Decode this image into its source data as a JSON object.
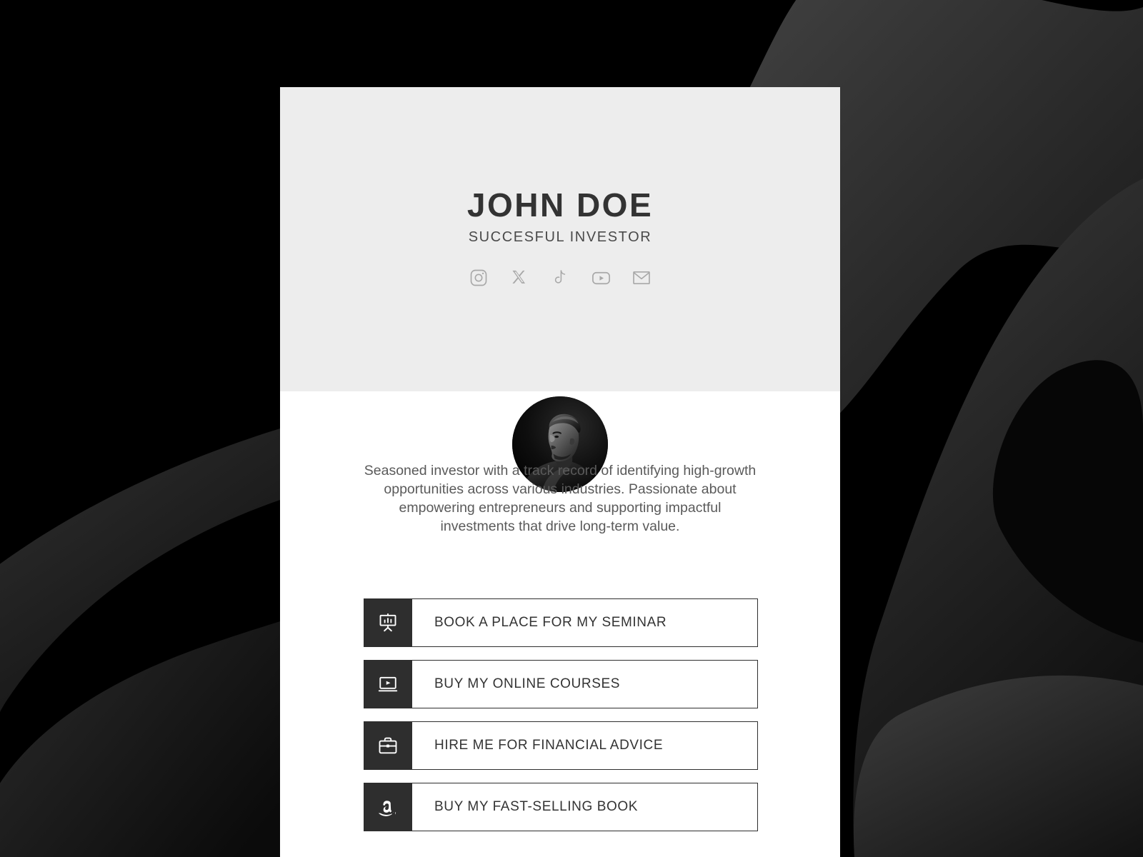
{
  "background": {
    "base_color": "#000000",
    "blob_colors": [
      "#2b2b2b",
      "#333333",
      "#1a1a1a",
      "#3a3a3a",
      "#202020"
    ]
  },
  "card": {
    "header_bg": "#ededed",
    "body_bg": "#ffffff",
    "accent": "#2e2e2e"
  },
  "profile": {
    "name": "JOHN DOE",
    "tagline": "SUCCESFUL INVESTOR",
    "bio": "Seasoned investor with a track record of identifying high-growth opportunities across various industries. Passionate about empowering entrepreneurs and supporting impactful investments that drive long-term value.",
    "avatar_alt": "portrait-photo-of-man-in-profile"
  },
  "socials": [
    {
      "name": "instagram",
      "icon": "instagram-icon"
    },
    {
      "name": "x",
      "icon": "x-twitter-icon"
    },
    {
      "name": "tiktok",
      "icon": "tiktok-icon"
    },
    {
      "name": "youtube",
      "icon": "youtube-icon"
    },
    {
      "name": "email",
      "icon": "mail-icon"
    }
  ],
  "links": [
    {
      "label": "BOOK A PLACE FOR MY SEMINAR",
      "icon": "presentation-chart-icon"
    },
    {
      "label": "BUY MY ONLINE COURSES",
      "icon": "video-player-icon"
    },
    {
      "label": "HIRE ME FOR FINANCIAL ADVICE",
      "icon": "briefcase-icon"
    },
    {
      "label": "BUY MY FAST-SELLING BOOK",
      "icon": "amazon-icon"
    }
  ]
}
